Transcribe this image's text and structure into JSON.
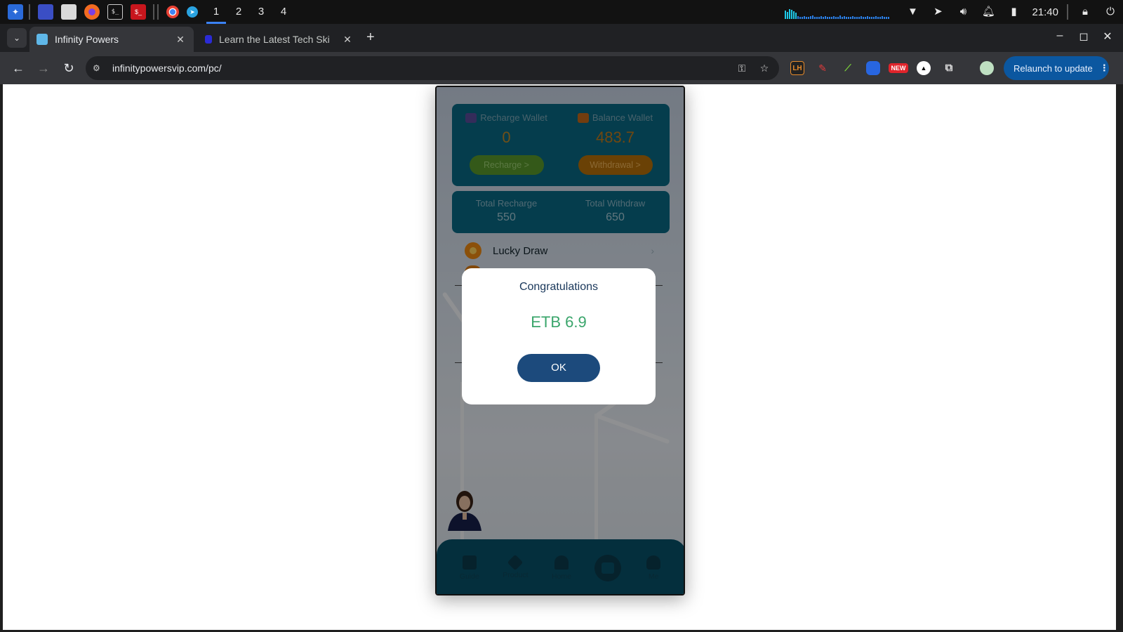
{
  "taskbar": {
    "workspaces": [
      "1",
      "2",
      "3",
      "4"
    ],
    "active_workspace": "1",
    "clock": "21:40",
    "launcher_icons": [
      "kali-menu-icon",
      "desktop-icon",
      "file-manager-icon",
      "firefox-icon",
      "terminal-icon",
      "root-terminal-icon",
      "chrome-icon",
      "telegram-icon"
    ],
    "tray_icons": [
      "wifi-icon",
      "telegram-tray-icon",
      "volume-icon",
      "bell-icon",
      "battery-icon",
      "lock-icon",
      "power-icon"
    ]
  },
  "browser": {
    "tabs": [
      {
        "title": "Infinity Powers",
        "active": true
      },
      {
        "title": "Learn the Latest Tech Ski",
        "active": false
      }
    ],
    "url": "infinitypowersvip.com/pc/",
    "relaunch_label": "Relaunch to update",
    "extensions": [
      "LH",
      "NEW"
    ]
  },
  "app": {
    "wallets": {
      "recharge": {
        "label": "Recharge Wallet",
        "value": "0",
        "button": "Recharge >"
      },
      "balance": {
        "label": "Balance Wallet",
        "value": "483.7",
        "button": "Withdrawal >"
      }
    },
    "totals": {
      "recharge": {
        "label": "Total Recharge",
        "value": "550"
      },
      "withdraw": {
        "label": "Total Withdraw",
        "value": "650"
      }
    },
    "menu": {
      "lucky_draw": "Lucky Draw"
    },
    "nav": [
      {
        "label": "Guide",
        "icon": "book-icon"
      },
      {
        "label": "Product",
        "icon": "layers-icon"
      },
      {
        "label": "Home",
        "icon": "home-icon"
      },
      {
        "label": "",
        "icon": "wallet-icon"
      },
      {
        "label": "Me",
        "icon": "user-icon"
      }
    ],
    "dialog": {
      "title": "Congratulations",
      "amount": "ETB 6.9",
      "ok": "OK"
    }
  },
  "colors": {
    "card": "#0a6a86",
    "nav": "#08526a",
    "dialog_button": "#1c4a7c",
    "amount": "#3aa56b",
    "relaunch": "#0b57a0"
  }
}
